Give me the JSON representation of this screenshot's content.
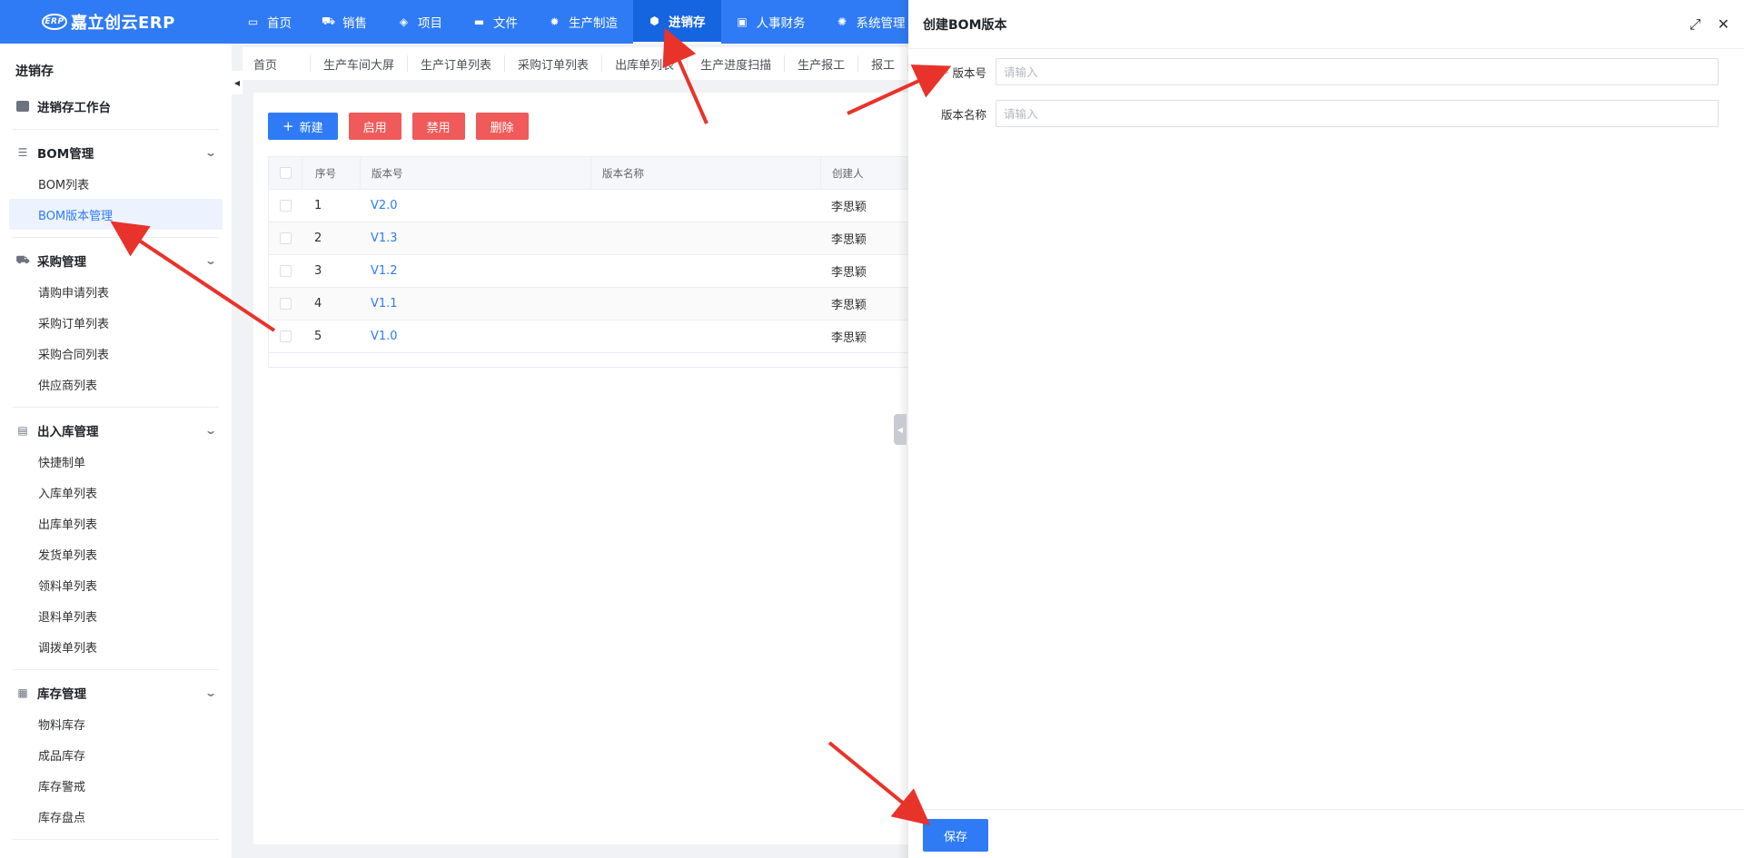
{
  "app": {
    "title": "嘉立创云ERP",
    "badge": "ERP"
  },
  "nav": [
    {
      "label": "首页",
      "icon": "monitor-icon",
      "active": false
    },
    {
      "label": "销售",
      "icon": "cart-icon",
      "active": false
    },
    {
      "label": "项目",
      "icon": "layers-icon",
      "active": false
    },
    {
      "label": "文件",
      "icon": "folder-icon",
      "active": false
    },
    {
      "label": "生产制造",
      "icon": "gear-icon",
      "active": false
    },
    {
      "label": "进销存",
      "icon": "cube-icon",
      "active": true
    },
    {
      "label": "人事财务",
      "icon": "money-icon",
      "active": false
    },
    {
      "label": "系统管理",
      "icon": "settings-icon",
      "active": false
    }
  ],
  "sidebar": {
    "title": "进销存",
    "workbench": "进销存工作台",
    "groups": [
      {
        "label": "BOM管理",
        "icon": "list-icon",
        "items": [
          "BOM列表",
          "BOM版本管理"
        ]
      },
      {
        "label": "采购管理",
        "icon": "cart-icon",
        "items": [
          "请购申请列表",
          "采购订单列表",
          "采购合同列表",
          "供应商列表"
        ]
      },
      {
        "label": "出入库管理",
        "icon": "box-icon",
        "items": [
          "快捷制单",
          "入库单列表",
          "出库单列表",
          "发货单列表",
          "领料单列表",
          "退料单列表",
          "调拨单列表"
        ]
      },
      {
        "label": "库存管理",
        "icon": "archive-icon",
        "items": [
          "物料库存",
          "成品库存",
          "库存警戒",
          "库存盘点"
        ]
      }
    ],
    "active_item": "BOM版本管理"
  },
  "tabs": [
    "首页",
    "生产车间大屏",
    "生产订单列表",
    "采购订单列表",
    "出库单列表",
    "生产进度扫描",
    "生产报工",
    "报工"
  ],
  "toolbar": {
    "new": "新建",
    "enable": "启用",
    "disable": "禁用",
    "delete": "删除"
  },
  "table": {
    "headers": {
      "index": "序号",
      "version": "版本号",
      "name": "版本名称",
      "creator": "创建人"
    },
    "rows": [
      {
        "index": "1",
        "version": "V2.0",
        "name": "",
        "creator": "李思颖"
      },
      {
        "index": "2",
        "version": "V1.3",
        "name": "",
        "creator": "李思颖"
      },
      {
        "index": "3",
        "version": "V1.2",
        "name": "",
        "creator": "李思颖"
      },
      {
        "index": "4",
        "version": "V1.1",
        "name": "",
        "creator": "李思颖"
      },
      {
        "index": "5",
        "version": "V1.0",
        "name": "",
        "creator": "李思颖"
      }
    ]
  },
  "drawer": {
    "title": "创建BOM版本",
    "fields": {
      "version_label": "版本号",
      "version_placeholder": "请输入",
      "version_value": "",
      "name_label": "版本名称",
      "name_placeholder": "请输入",
      "name_value": ""
    },
    "save": "保存"
  },
  "colors": {
    "primary": "#2f7bf5",
    "danger": "#f05a5a",
    "arrow": "#e8332a"
  }
}
